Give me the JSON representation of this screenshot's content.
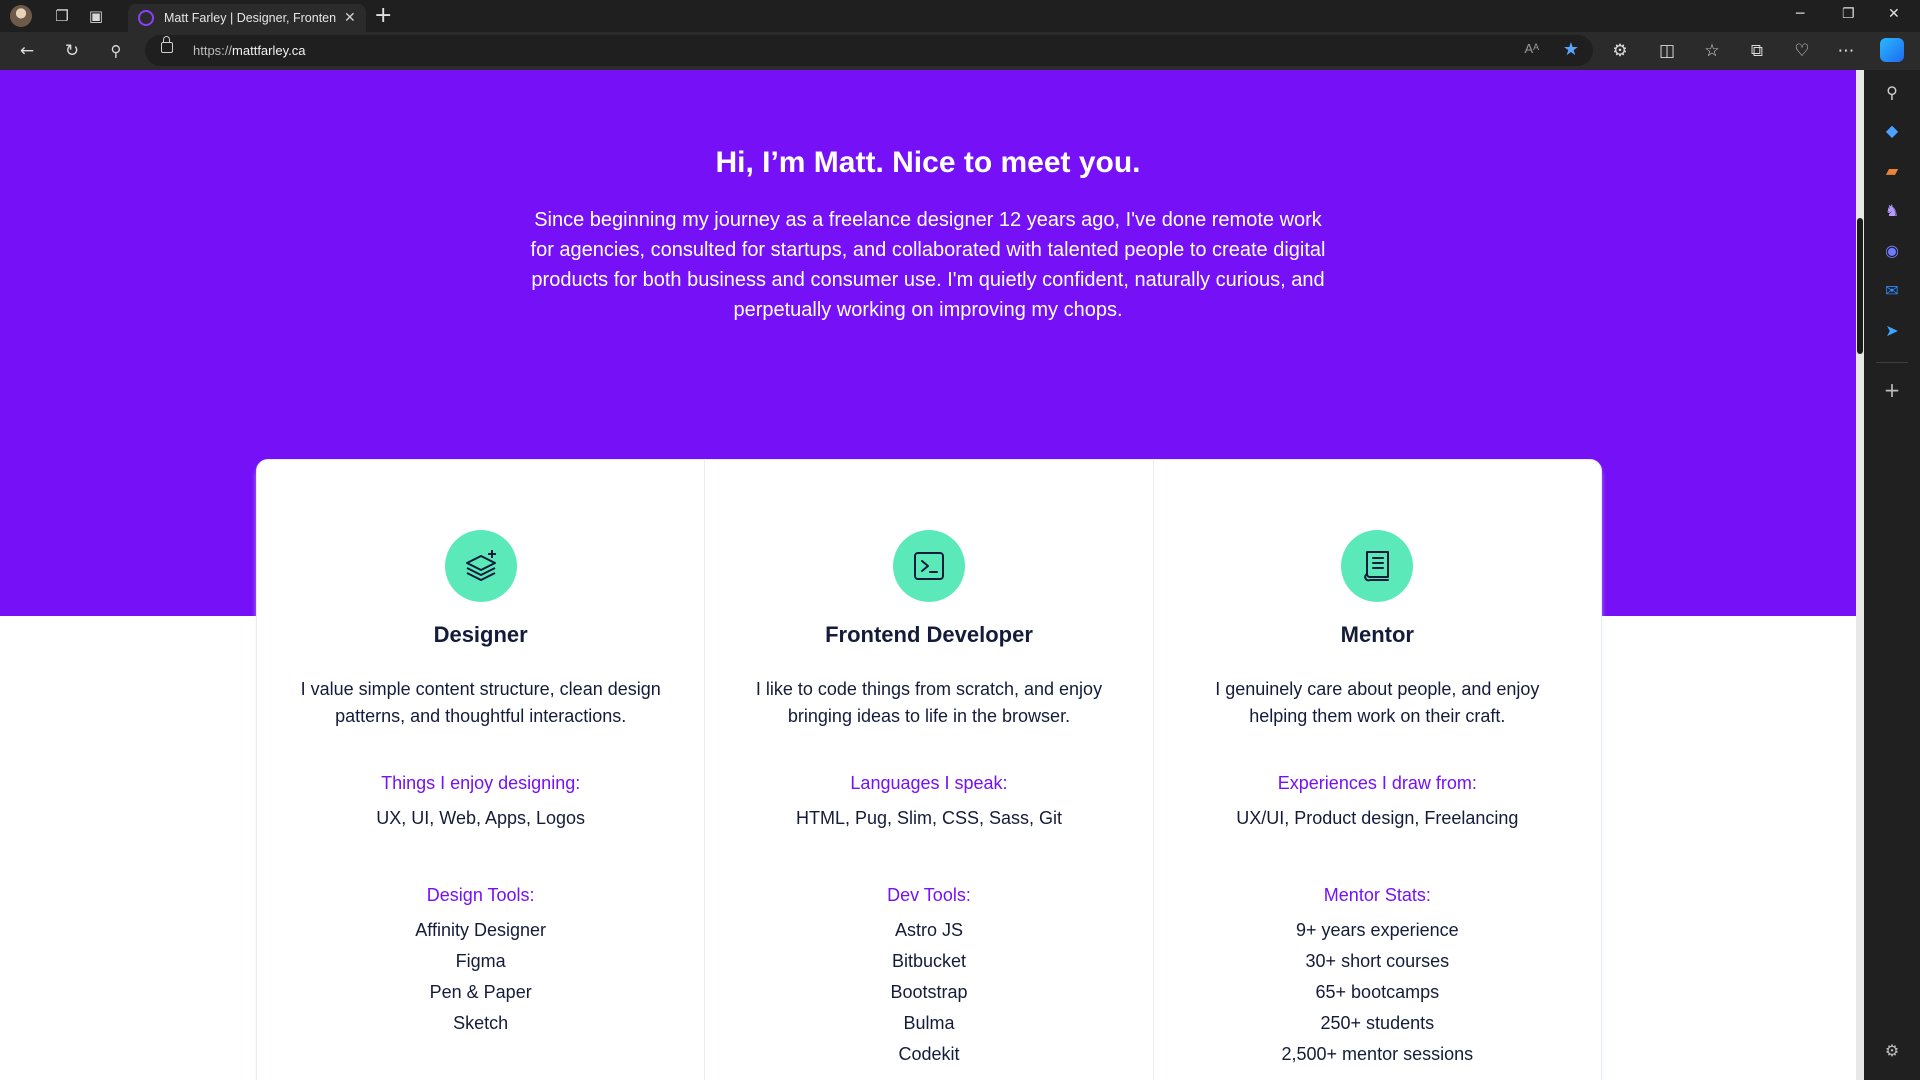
{
  "browser": {
    "tab_title": "Matt Farley | Designer, Frontend",
    "url_scheme": "https://",
    "url_host": "mattfarley.ca",
    "read_aloud_label": "Aᴬ"
  },
  "hero": {
    "title": "Hi, I’m Matt. Nice to meet you.",
    "intro": "Since beginning my journey as a freelance designer 12 years ago, I've done remote work for agencies, consulted for startups, and collaborated with talented people to create digital products for both business and consumer use. I'm quietly confident, naturally curious, and perpetually working on improving my chops."
  },
  "skills": [
    {
      "title": "Designer",
      "icon": "layers-icon",
      "description": "I value simple content structure, clean design patterns, and thoughtful interactions.",
      "heading1": "Things I enjoy designing:",
      "line1": "UX, UI, Web, Apps, Logos",
      "heading2": "Design Tools:",
      "tools": [
        "Affinity Designer",
        "Figma",
        "Pen & Paper",
        "Sketch"
      ]
    },
    {
      "title": "Frontend Developer",
      "icon": "terminal-icon",
      "description": "I like to code things from scratch, and enjoy bringing ideas to life in the browser.",
      "heading1": "Languages I speak:",
      "line1": "HTML, Pug, Slim, CSS, Sass, Git",
      "heading2": "Dev Tools:",
      "tools": [
        "Astro JS",
        "Bitbucket",
        "Bootstrap",
        "Bulma",
        "Codekit"
      ]
    },
    {
      "title": "Mentor",
      "icon": "book-icon",
      "description": "I genuinely care about people, and enjoy helping them work on their craft.",
      "heading1": "Experiences I draw from:",
      "line1": "UX/UI, Product design, Freelancing",
      "heading2": "Mentor Stats:",
      "tools": [
        "9+ years experience",
        "30+ short courses",
        "65+ bootcamps",
        "250+ students",
        "2,500+ mentor sessions"
      ]
    }
  ],
  "colors": {
    "hero_bg": "#7510f7",
    "icon_bg": "#5be9b9",
    "heading_accent": "#7510f7",
    "text_dark": "#141c3a"
  }
}
